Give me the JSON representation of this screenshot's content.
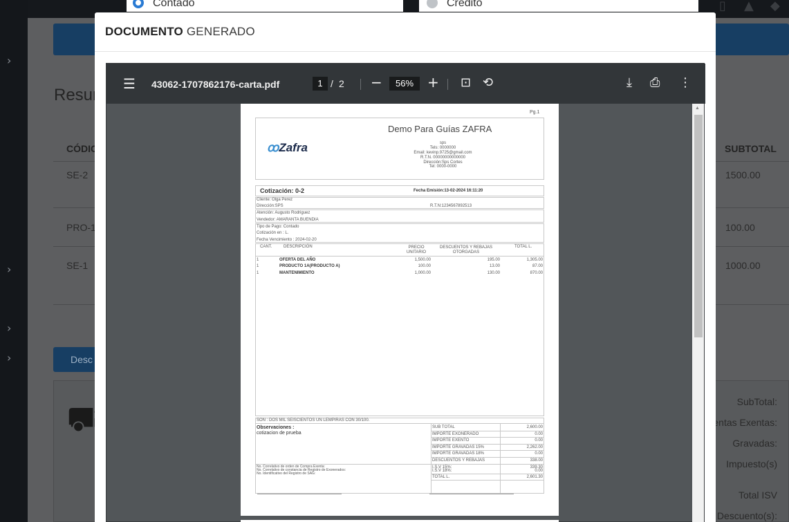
{
  "background": {
    "radio_contado": "Contado",
    "radio_credito": "Crédito",
    "section_title": "Resum",
    "table_headers": {
      "code": "CÓDIC",
      "subtotal": "SUBTOTAL"
    },
    "rows": [
      {
        "code": "SE-2",
        "subtotal": "1500.00"
      },
      {
        "code": "PRO-1",
        "subtotal": "100.00"
      },
      {
        "code": "SE-1",
        "subtotal": "1000.00"
      }
    ],
    "button": "Desc",
    "summary": [
      "SubTotal:",
      "entas Exentas:",
      "Gravadas:",
      "Impuesto(s)",
      "Total ISV",
      "Descuento(s):"
    ]
  },
  "modal": {
    "title_bold": "DOCUMENTO",
    "title_rest": "GENERADO"
  },
  "viewer": {
    "filename": "43062-1707862176-carta.pdf",
    "page_current": "1",
    "page_sep": "/",
    "page_total": "2",
    "zoom": "56%",
    "icons": [
      "menu-icon",
      "zoom-out-icon",
      "zoom-in-icon",
      "fit-page-icon",
      "rotate-icon",
      "download-icon",
      "print-icon",
      "more-icon"
    ]
  },
  "document": {
    "page_label": "Pg.1",
    "logo": "Zafra",
    "company": "Demo Para Guías ZAFRA",
    "company_lines": [
      "sps",
      "Tels: 0000000",
      "Email: kevinp.9725@gmail.com",
      "R.T.N. 00000000000000",
      "Dirección:Sps Cortes",
      "Tel: 0000-0000"
    ],
    "quote_title": "Cotización: 0-2",
    "emission": "Fecha Emisión:13-02-2024 16:11:20",
    "client": "Cliente: Olga Perez",
    "address": "Dirección:SPS",
    "rtn": "R.T.N:1234567892513",
    "attention": "Atención: Augusto Rodriguez",
    "seller": "Vendedor: AMARANTA BUENDIA",
    "payment": "Tipo de Pago: Contado",
    "currency": "Cotización en : L.",
    "due": "Fecha Vencimiento : 2024-02-20",
    "headers": {
      "qty": "CANT.",
      "desc": "DESCRIPCIÓN",
      "price": "PRECIO UNITARIO",
      "disc": "DESCUENTOS Y REBAJAS OTORGADAS",
      "total": "TOTAL L."
    },
    "items": [
      {
        "qty": "1",
        "desc": "OFERTA DEL AÑO",
        "price": "1,500.00",
        "disc": "195.00",
        "total": "1,305.00"
      },
      {
        "qty": "1",
        "desc": "PRODUCTO 1A(PRODUCTO A)",
        "price": "100.00",
        "disc": "13.00",
        "total": "87.00"
      },
      {
        "qty": "1",
        "desc": "MANTENIMIENTO",
        "price": "1,000.00",
        "disc": "130.00",
        "total": "870.00"
      }
    ],
    "amount_words": "SON : DOS MIL SEISCIENTOS UN LEMPIRAS CON 30/100.",
    "obs_label": "Observaciones :",
    "obs_text": "cotizacion de prueba",
    "totals": [
      {
        "label": "SUB TOTAL",
        "value": "2,600.00"
      },
      {
        "label": "IMPORTE EXONERADO",
        "value": "0.00"
      },
      {
        "label": "IMPORTE EXENTO",
        "value": "0.00"
      },
      {
        "label": "IMPORTE GRAVADAS 15%",
        "value": "2,262.00"
      },
      {
        "label": "IMPORTE GRAVADAS 18%",
        "value": "0.00"
      },
      {
        "label": "DESCUENTOS Y REBAJAS",
        "value": "338.00"
      },
      {
        "label": "I.S.V 15%:",
        "value": "339.30"
      },
      {
        "label": "I.S.V 18%:",
        "value": "0.00"
      },
      {
        "label": "TOTAL L.",
        "value": "2,601.30"
      }
    ],
    "fiscal_lines": [
      "No. Correlativo de orden de Compra Exenta:",
      "No. Correlativo de constancia de Registro de Exonerados:",
      "No. Identificativo del Registro de SAG:"
    ]
  }
}
